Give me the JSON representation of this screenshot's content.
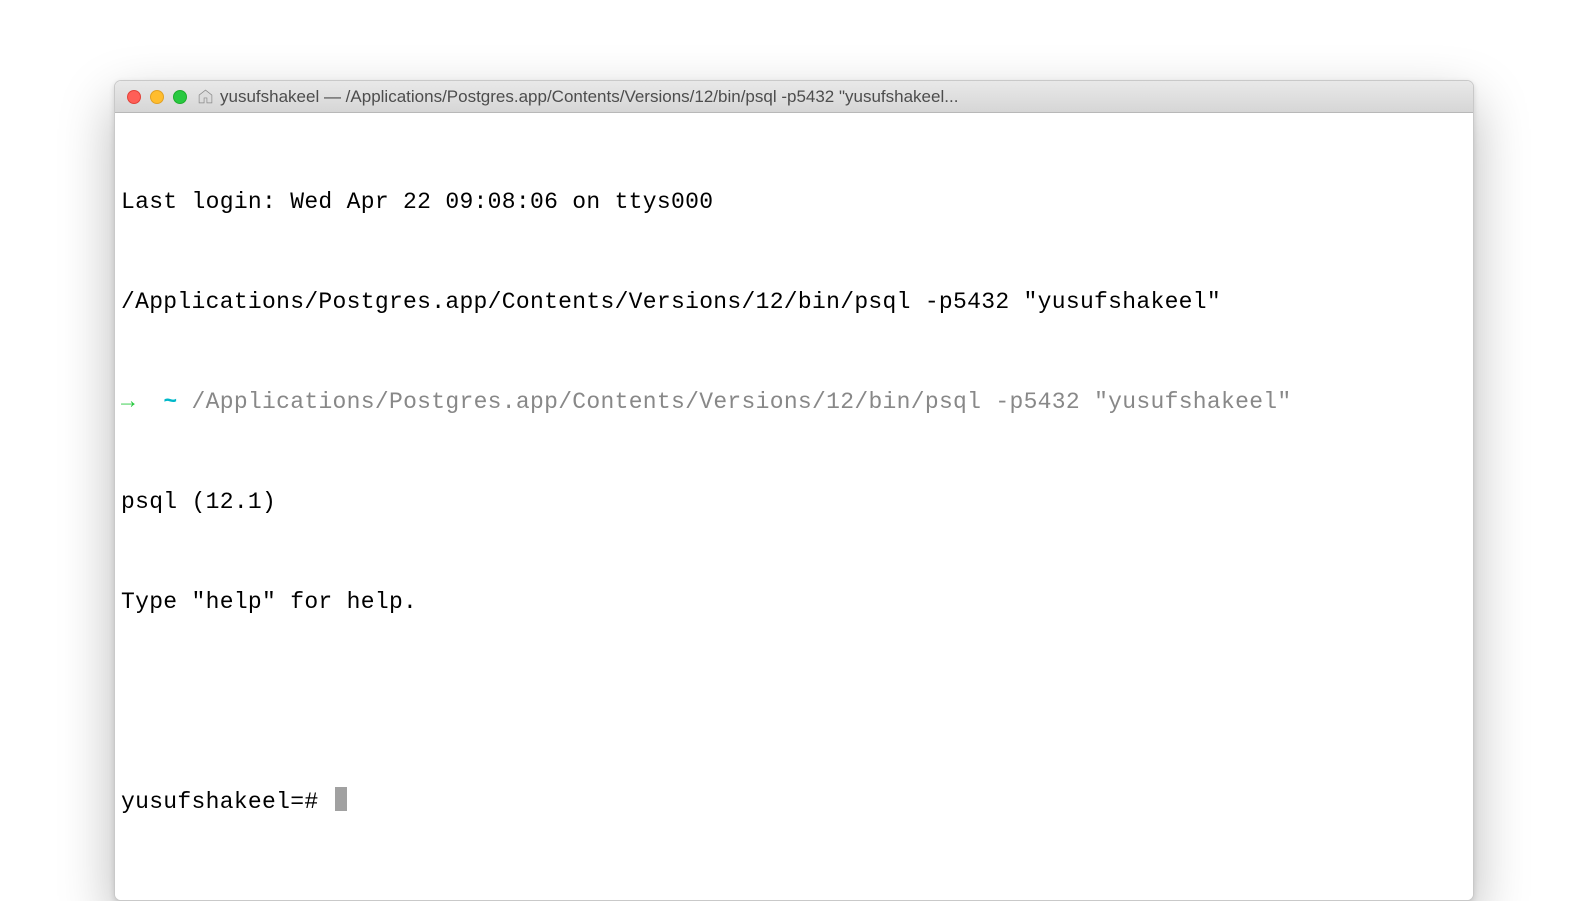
{
  "window": {
    "title": "yusufshakeel — /Applications/Postgres.app/Contents/Versions/12/bin/psql -p5432 \"yusufshakeel..."
  },
  "terminal": {
    "line1": "Last login: Wed Apr 22 09:08:06 on ttys000",
    "line2": "/Applications/Postgres.app/Contents/Versions/12/bin/psql -p5432 \"yusufshakeel\"",
    "prompt_arrow": "→ ",
    "prompt_tilde": " ~ ",
    "line3_cmd": "/Applications/Postgres.app/Contents/Versions/12/bin/psql -p5432 \"yusufshakeel\"",
    "line4": "psql (12.1)",
    "line5": "Type \"help\" for help.",
    "psql_prompt": "yusufshakeel=# "
  }
}
